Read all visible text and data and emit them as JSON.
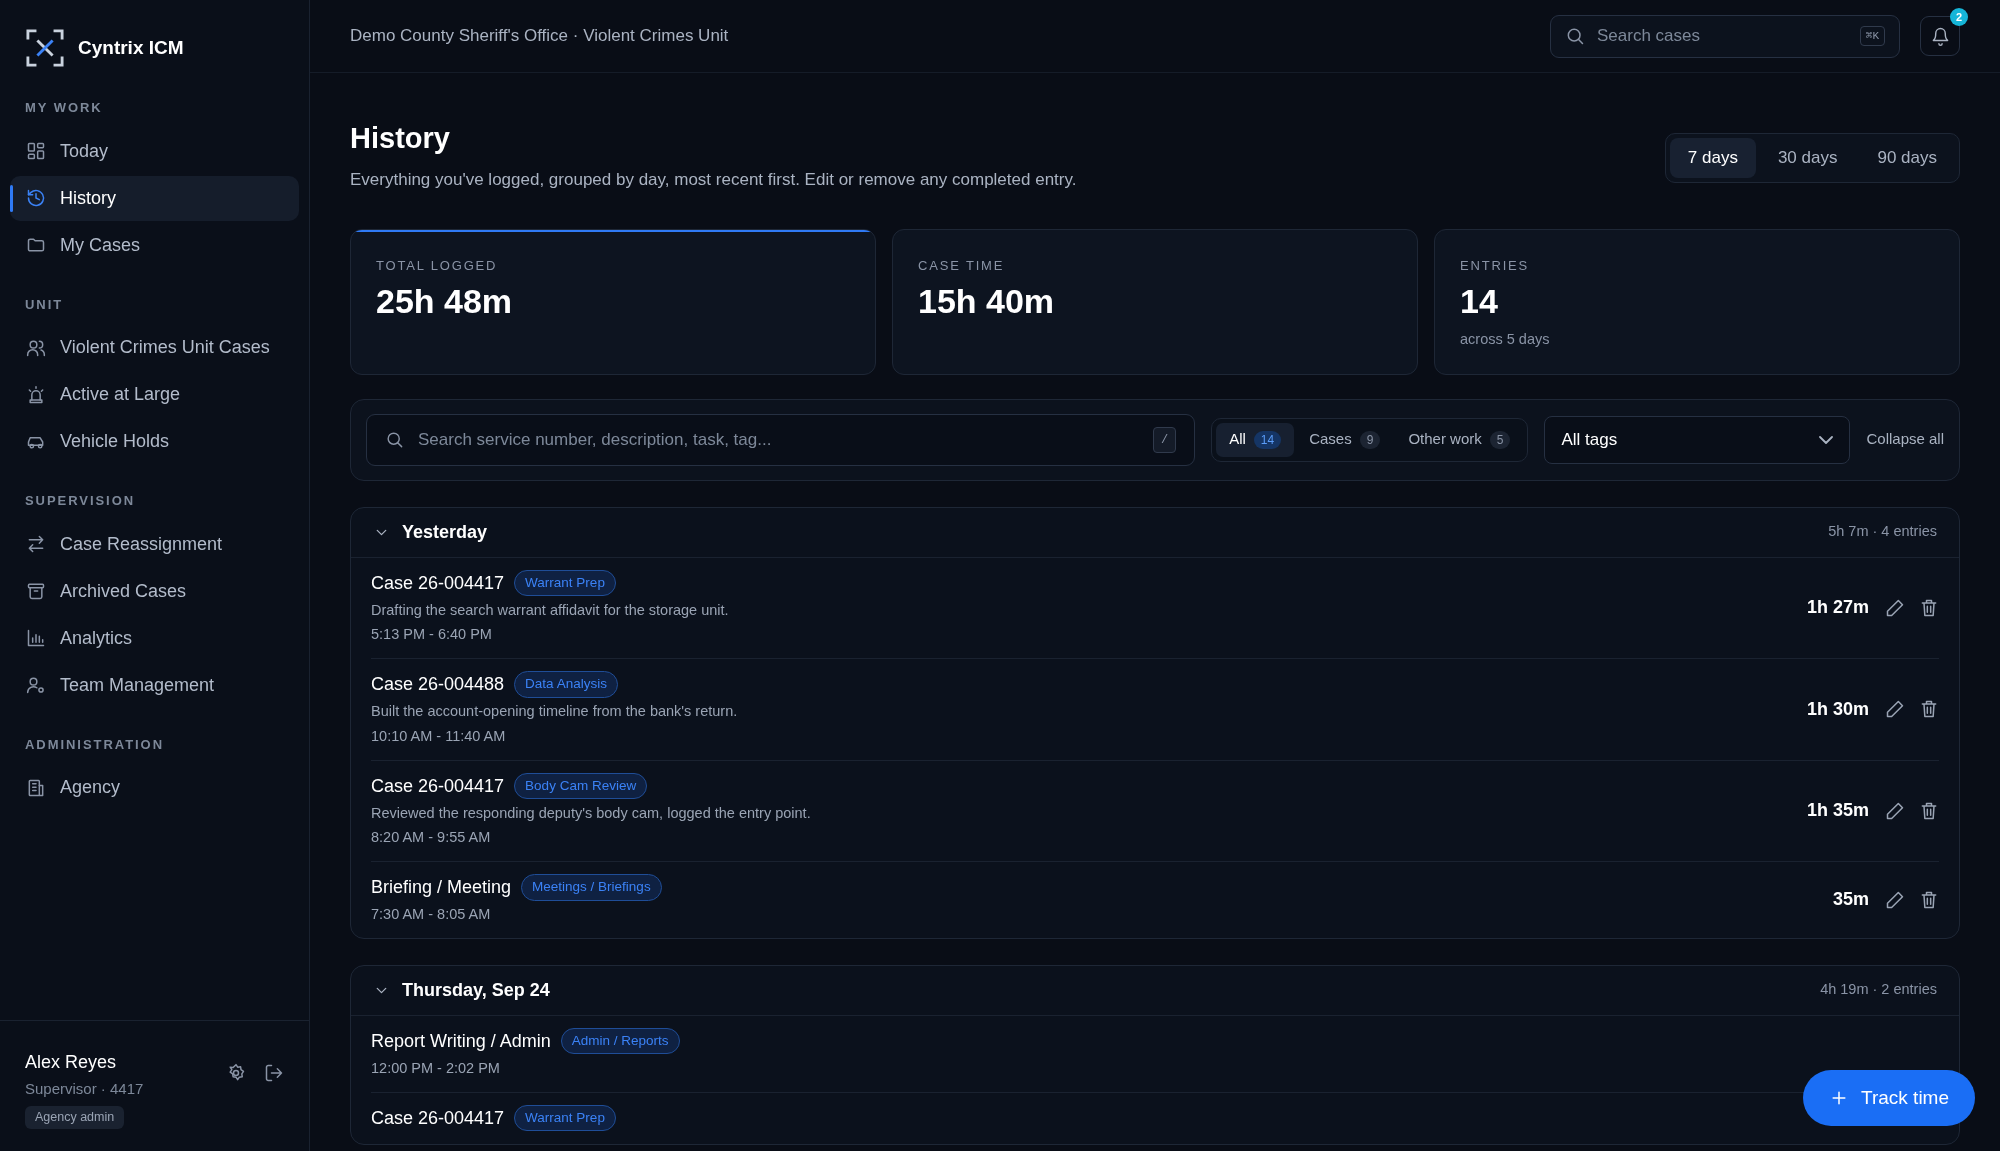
{
  "app": {
    "name": "Cyntrix ICM"
  },
  "sidebar": {
    "sections": [
      {
        "heading": "MY WORK",
        "items": [
          {
            "label": "Today",
            "selected": false
          },
          {
            "label": "History",
            "selected": true
          },
          {
            "label": "My Cases",
            "selected": false
          }
        ]
      },
      {
        "heading": "UNIT",
        "items": [
          {
            "label": "Violent Crimes Unit Cases",
            "selected": false
          },
          {
            "label": "Active at Large",
            "selected": false
          },
          {
            "label": "Vehicle Holds",
            "selected": false
          }
        ]
      },
      {
        "heading": "SUPERVISION",
        "items": [
          {
            "label": "Case Reassignment",
            "selected": false
          },
          {
            "label": "Archived Cases",
            "selected": false
          },
          {
            "label": "Analytics",
            "selected": false
          },
          {
            "label": "Team Management",
            "selected": false
          }
        ]
      },
      {
        "heading": "ADMINISTRATION",
        "items": [
          {
            "label": "Agency",
            "selected": false
          }
        ]
      }
    ]
  },
  "user": {
    "name": "Alex Reyes",
    "role": "Supervisor · 4417",
    "badge": "Agency admin"
  },
  "header": {
    "breadcrumb": "Demo County Sheriff's Office · Violent Crimes Unit",
    "search": {
      "placeholder": "Search cases",
      "shortcut": "⌘K"
    },
    "notifications": "2"
  },
  "page": {
    "title": "History",
    "subtitle": "Everything you've logged, grouped by day, most recent first. Edit or remove any completed entry."
  },
  "ranges": [
    {
      "label": "7 days",
      "selected": true
    },
    {
      "label": "30 days",
      "selected": false
    },
    {
      "label": "90 days",
      "selected": false
    }
  ],
  "stats": [
    {
      "label": "TOTAL LOGGED",
      "value": "25h 48m",
      "highlighted": true
    },
    {
      "label": "CASE TIME",
      "value": "15h 40m",
      "highlighted": false
    },
    {
      "label": "ENTRIES",
      "value": "14",
      "note": "across 5 days",
      "highlighted": false
    }
  ],
  "filters": {
    "search": {
      "placeholder": "Search service number, description, task, tag...",
      "shortcut": "/"
    },
    "types": [
      {
        "label": "All",
        "count": "14",
        "selected": true
      },
      {
        "label": "Cases",
        "count": "9",
        "selected": false
      },
      {
        "label": "Other work",
        "count": "5",
        "selected": false
      }
    ],
    "tags": "All tags",
    "collapse": "Collapse all"
  },
  "groups": [
    {
      "title": "Yesterday",
      "expanded": true,
      "summary": "5h 7m · 4 entries",
      "entries": [
        {
          "title": "Case 26-004417",
          "tag": "Warrant Prep",
          "description": "Drafting the search warrant affidavit for the storage unit.",
          "time": "5:13 PM - 6:40 PM",
          "duration": "1h 27m"
        },
        {
          "title": "Case 26-004488",
          "tag": "Data Analysis",
          "description": "Built the account-opening timeline from the bank's return.",
          "time": "10:10 AM - 11:40 AM",
          "duration": "1h 30m"
        },
        {
          "title": "Case 26-004417",
          "tag": "Body Cam Review",
          "description": "Reviewed the responding deputy's body cam, logged the entry point.",
          "time": "8:20 AM - 9:55 AM",
          "duration": "1h 35m"
        },
        {
          "title": "Briefing / Meeting",
          "tag": "Meetings / Briefings",
          "time": "7:30 AM - 8:05 AM",
          "duration": "35m"
        }
      ]
    },
    {
      "title": "Thursday, Sep 24",
      "expanded": true,
      "summary": "4h 19m · 2 entries",
      "entries": [
        {
          "title": "Report Writing / Admin",
          "tag": "Admin / Reports",
          "time": "12:00 PM - 2:02 PM"
        },
        {
          "title": "Case 26-004417",
          "tag": "Warrant Prep"
        }
      ]
    }
  ],
  "fab": "Track time"
}
